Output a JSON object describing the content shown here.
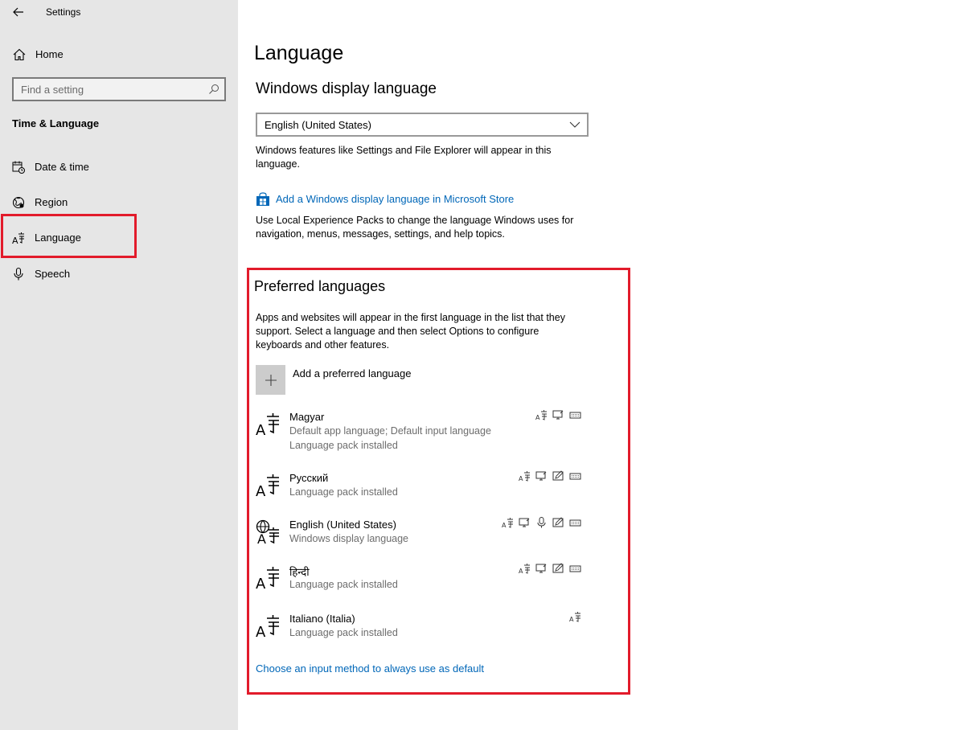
{
  "window": {
    "app_title": "Settings"
  },
  "sidebar": {
    "home_label": "Home",
    "search": {
      "placeholder": "Find a setting"
    },
    "section_heading": "Time & Language",
    "items": [
      {
        "label": "Date & time",
        "icon": "calendar-clock-icon"
      },
      {
        "label": "Region",
        "icon": "globe-region-icon"
      },
      {
        "label": "Language",
        "icon": "language-icon",
        "selected": true
      },
      {
        "label": "Speech",
        "icon": "microphone-icon"
      }
    ]
  },
  "main": {
    "page_title": "Language",
    "display_language": {
      "heading": "Windows display language",
      "selected_value": "English (United States)",
      "description": "Windows features like Settings and File Explorer will appear in this language.",
      "store_link": "Add a Windows display language in Microsoft Store",
      "lxp_description": "Use Local Experience Packs to change the language Windows uses for navigation, menus, messages, settings, and help topics."
    },
    "preferred": {
      "heading": "Preferred languages",
      "description": "Apps and websites will appear in the first language in the list that they support. Select a language and then select Options to configure keyboards and other features.",
      "add_label": "Add a preferred language",
      "languages": [
        {
          "name": "Magyar",
          "sub1": "Default app language; Default input language",
          "sub2": "Language pack installed",
          "features": [
            "language-pack-icon",
            "display-icon",
            "keyboard-icon"
          ]
        },
        {
          "name": "Русский",
          "sub1": "Language pack installed",
          "features": [
            "language-pack-icon",
            "display-icon",
            "handwriting-icon",
            "keyboard-icon"
          ]
        },
        {
          "name": "English (United States)",
          "sub1": "Windows display language",
          "features": [
            "language-pack-icon",
            "display-icon",
            "microphone-icon",
            "handwriting-icon",
            "keyboard-icon"
          ]
        },
        {
          "name": "हिन्दी",
          "sub1": "Language pack installed",
          "features": [
            "language-pack-icon",
            "display-icon",
            "handwriting-icon",
            "keyboard-icon"
          ]
        },
        {
          "name": "Italiano (Italia)",
          "sub1": "Language pack installed",
          "features": [
            "language-pack-icon"
          ]
        }
      ],
      "default_input_link": "Choose an input method to always use as default"
    }
  },
  "colors": {
    "sidebar_bg": "#e6e6e6",
    "link": "#0067b8",
    "highlight": "#e21b2b",
    "secondary_text": "#6d6d6d"
  }
}
